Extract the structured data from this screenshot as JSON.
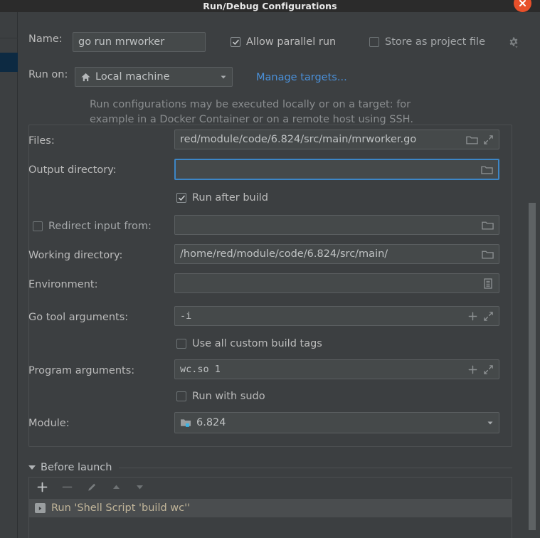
{
  "window": {
    "title": "Run/Debug Configurations",
    "close_icon": "close-icon"
  },
  "form": {
    "name_label": "Name:",
    "name_value": "go run mrworker",
    "allow_parallel_run_label": "Allow parallel run",
    "allow_parallel_run_checked": true,
    "store_as_project_file_label": "Store as project file",
    "store_as_project_file_checked": false,
    "gear_icon": "gear-icon",
    "run_on_label": "Run on:",
    "run_on_value": "Local machine",
    "run_on_icon": "home-icon",
    "manage_targets_link": "Manage targets...",
    "hint_line1": "Run configurations may be executed locally or on a target: for",
    "hint_line2": "example in a Docker Container or on a remote host using SSH.",
    "files_label": "Files:",
    "files_value": "red/module/code/6.824/src/main/mrworker.go",
    "output_directory_label": "Output directory:",
    "output_directory_value": "",
    "run_after_build_label": "Run after build",
    "run_after_build_checked": true,
    "redirect_input_label": "Redirect input from:",
    "redirect_input_checked": false,
    "redirect_input_value": "",
    "working_directory_label": "Working directory:",
    "working_directory_value": "/home/red/module/code/6.824/src/main/",
    "environment_label": "Environment:",
    "environment_value": "",
    "go_tool_arguments_label": "Go tool arguments:",
    "go_tool_arguments_value": "-i",
    "use_all_custom_build_tags_label": "Use all custom build tags",
    "use_all_custom_build_tags_checked": false,
    "program_arguments_label": "Program arguments:",
    "program_arguments_value": "wc.so 1",
    "run_with_sudo_label": "Run with sudo",
    "run_with_sudo_checked": false,
    "module_label": "Module:",
    "module_value": "6.824",
    "module_icon": "module-folder-icon"
  },
  "before_launch": {
    "section_title": "Before launch",
    "toolbar": [
      {
        "name": "add-button",
        "icon": "plus-icon",
        "enabled": true
      },
      {
        "name": "remove-button",
        "icon": "minus-icon",
        "enabled": false
      },
      {
        "name": "edit-button",
        "icon": "pencil-icon",
        "enabled": false
      },
      {
        "name": "move-up-button",
        "icon": "arrow-up-icon",
        "enabled": false
      },
      {
        "name": "move-down-button",
        "icon": "arrow-down-icon",
        "enabled": false
      }
    ],
    "tasks": [
      {
        "icon": "run-script-icon",
        "label": "Run 'Shell Script 'build wc''"
      }
    ]
  },
  "colors": {
    "background": "#3c3f41",
    "titlebar": "#2b2b2b",
    "accent_blue": "#3d86c6",
    "link_blue": "#4a90d9",
    "close_orange": "#e8502a",
    "selection_blue": "#0d2a42",
    "field_bg": "#45494a",
    "task_text": "#c2b69a"
  }
}
